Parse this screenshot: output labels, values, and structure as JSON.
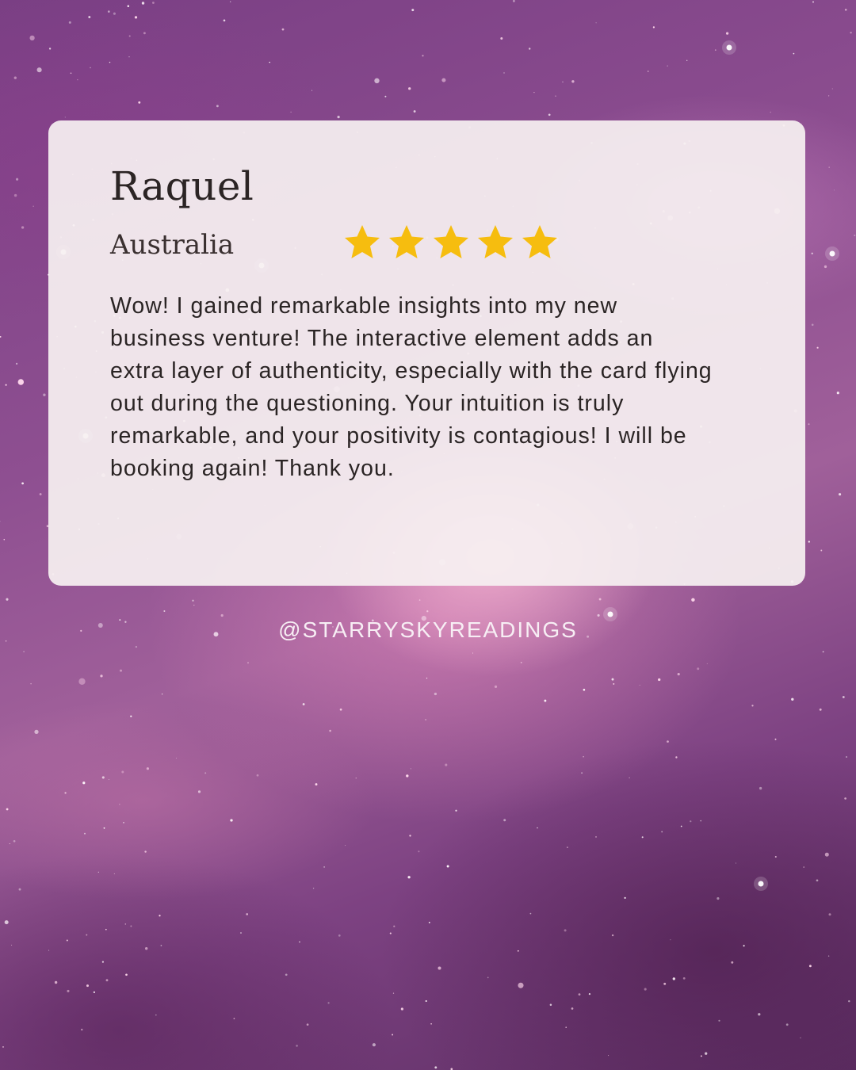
{
  "review": {
    "name": "Raquel",
    "location": "Australia",
    "rating": 5,
    "rating_max": 5,
    "text": "Wow! I gained remarkable insights into my new business venture! The interactive element adds an extra layer of authenticity, especially with the card flying out during the questioning. Your intuition is truly remarkable, and your positivity is contagious! I will be booking again! Thank you."
  },
  "footer": {
    "handle": "@STARRYSKYREADINGS"
  },
  "colors": {
    "star": "#f6bd0f",
    "card": "#f6f0f1",
    "text": "#2a2424",
    "background": "#8e4f91"
  },
  "icons": {
    "rating_star": "star-icon"
  }
}
